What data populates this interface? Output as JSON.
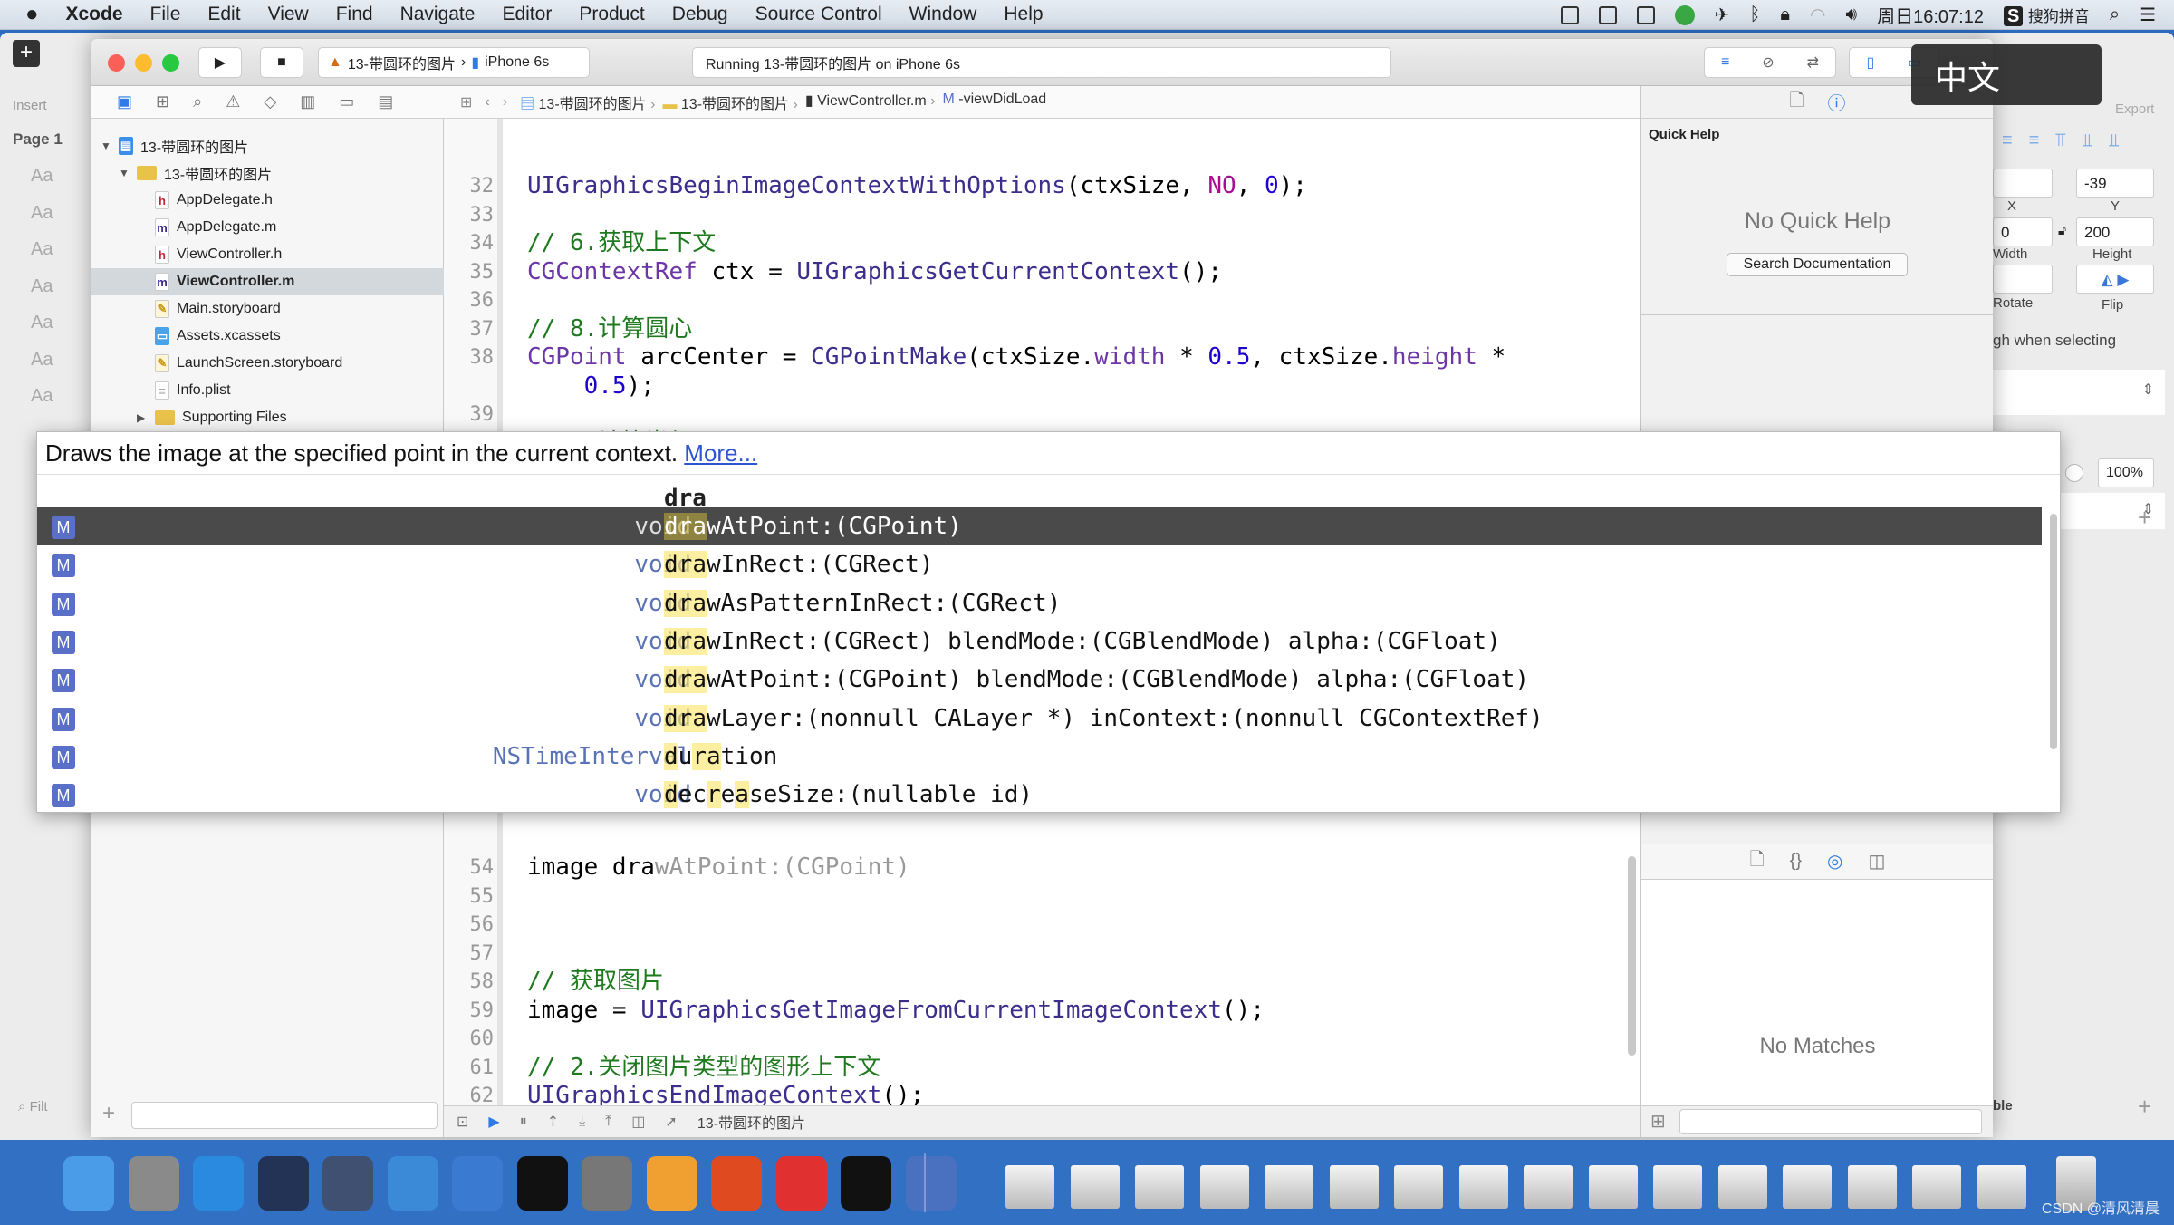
{
  "menubar": {
    "app": "Xcode",
    "items": [
      "File",
      "Edit",
      "View",
      "Find",
      "Navigate",
      "Editor",
      "Product",
      "Debug",
      "Source Control",
      "Window",
      "Help"
    ],
    "clock": "周日16:07:12",
    "ime": "搜狗拼音"
  },
  "ime_overlay": "中文",
  "sketch": {
    "insert": "Insert",
    "export": "Export",
    "page": "Page 1",
    "aa": [
      "Aa",
      "Aa",
      "Aa",
      "Aa",
      "Aa",
      "Aa",
      "Aa"
    ],
    "filter": "Filt",
    "x_label": "X",
    "y_label": "Y",
    "y_value": "-39",
    "width_value": "0",
    "height_value": "200",
    "width_label": "Width",
    "height_label": "Height",
    "rotate_label": "Rotate",
    "flip_label": "Flip",
    "select_through": "gh when selecting",
    "opacity": "100%",
    "bottom_label": "ble"
  },
  "toolbar": {
    "scheme": "13-带圆环的图片",
    "device": "iPhone 6s",
    "activity": "Running 13-带圆环的图片 on iPhone 6s"
  },
  "jumpbar": [
    "13-带圆环的图片",
    "13-带圆环的图片",
    "ViewController.m",
    "-viewDidLoad"
  ],
  "navigator": {
    "items": [
      {
        "label": "13-带圆环的图片",
        "icon": "project",
        "level": 0,
        "disclosure": "open"
      },
      {
        "label": "13-带圆环的图片",
        "icon": "folder",
        "level": 1,
        "disclosure": "open"
      },
      {
        "label": "AppDelegate.h",
        "icon": "h",
        "level": 2
      },
      {
        "label": "AppDelegate.m",
        "icon": "m",
        "level": 2
      },
      {
        "label": "ViewController.h",
        "icon": "h",
        "level": 2
      },
      {
        "label": "ViewController.m",
        "icon": "m",
        "level": 2,
        "selected": true
      },
      {
        "label": "Main.storyboard",
        "icon": "storyboard",
        "level": 2
      },
      {
        "label": "Assets.xcassets",
        "icon": "assets",
        "level": 2
      },
      {
        "label": "LaunchScreen.storyboard",
        "icon": "storyboard",
        "level": 2
      },
      {
        "label": "Info.plist",
        "icon": "plist",
        "level": 2
      },
      {
        "label": "Supporting Files",
        "icon": "folder",
        "level": 2,
        "disclosure": "closed"
      }
    ]
  },
  "code_top": [
    {
      "n": "32",
      "tokens": [
        [
          "UIGraphicsBeginImageContextWithOptions",
          "fn"
        ],
        [
          "(ctxSize, ",
          "pl"
        ],
        [
          "NO",
          "kw"
        ],
        [
          ", ",
          "pl"
        ],
        [
          "0",
          "num"
        ],
        [
          ");",
          "pl"
        ]
      ]
    },
    {
      "n": "33",
      "tokens": []
    },
    {
      "n": "34",
      "tokens": [
        [
          "// 6.获取上下文",
          "cm"
        ]
      ]
    },
    {
      "n": "35",
      "tokens": [
        [
          "CGContextRef",
          "ty"
        ],
        [
          " ctx = ",
          "pl"
        ],
        [
          "UIGraphicsGetCurrentContext",
          "fn"
        ],
        [
          "();",
          "pl"
        ]
      ]
    },
    {
      "n": "36",
      "tokens": []
    },
    {
      "n": "37",
      "tokens": [
        [
          "// 8.计算圆心",
          "cm"
        ]
      ]
    },
    {
      "n": "38",
      "tokens": [
        [
          "CGPoint",
          "ty"
        ],
        [
          " arcCenter = ",
          "pl"
        ],
        [
          "CGPointMake",
          "fn"
        ],
        [
          "(ctxSize.",
          "pl"
        ],
        [
          "width",
          "pr"
        ],
        [
          " * ",
          "pl"
        ],
        [
          "0.5",
          "num"
        ],
        [
          ", ctxSize.",
          "pl"
        ],
        [
          "height",
          "pr"
        ],
        [
          " *",
          "pl"
        ]
      ]
    },
    {
      "n": "",
      "tokens": [
        [
          "    ",
          "pl"
        ],
        [
          "0.5",
          "num"
        ],
        [
          ");",
          "pl"
        ]
      ]
    },
    {
      "n": "39",
      "tokens": []
    },
    {
      "n": "40",
      "tokens": [
        [
          "// 9.计算半径",
          "cm"
        ]
      ]
    },
    {
      "n": "41",
      "tokens": [
        [
          "CGFloat",
          "ty"
        ],
        [
          " radius = (image.size.width + margin) * ",
          "pl"
        ],
        [
          "0.5",
          "num"
        ],
        [
          ";",
          "pl"
        ]
      ]
    }
  ],
  "code_bottom": [
    {
      "n": "54",
      "tokens": [
        [
          "image dra",
          "pl"
        ],
        [
          "wAtPoint:(CGPoint)",
          "ghost"
        ]
      ]
    },
    {
      "n": "55",
      "tokens": []
    },
    {
      "n": "56",
      "tokens": []
    },
    {
      "n": "57",
      "tokens": []
    },
    {
      "n": "58",
      "tokens": [
        [
          "// 获取图片",
          "cm"
        ]
      ]
    },
    {
      "n": "59",
      "tokens": [
        [
          "image = ",
          "pl"
        ],
        [
          "UIGraphicsGetImageFromCurrentImageContext",
          "fn"
        ],
        [
          "();",
          "pl"
        ]
      ]
    },
    {
      "n": "60",
      "tokens": []
    },
    {
      "n": "61",
      "tokens": [
        [
          "// 2.关闭图片类型的图形上下文",
          "cm"
        ]
      ]
    },
    {
      "n": "62",
      "tokens": [
        [
          "UIGraphicsEndImageContext",
          "fn"
        ],
        [
          "();",
          "pl"
        ]
      ]
    },
    {
      "n": "63",
      "tokens": []
    }
  ],
  "completion": {
    "description": "Draws the image at the specified point in the current context.",
    "more_link": "More...",
    "typed": "dra",
    "badge": "M",
    "items": [
      {
        "type": "void",
        "name": "drawAtPoint:(CGPoint)",
        "selected": true
      },
      {
        "type": "void",
        "name": "drawInRect:(CGRect)"
      },
      {
        "type": "void",
        "name": "drawAsPatternInRect:(CGRect)"
      },
      {
        "type": "void",
        "name": "drawInRect:(CGRect) blendMode:(CGBlendMode) alpha:(CGFloat)"
      },
      {
        "type": "void",
        "name": "drawAtPoint:(CGPoint) blendMode:(CGBlendMode) alpha:(CGFloat)"
      },
      {
        "type": "void",
        "name": "drawLayer:(nonnull CALayer *) inContext:(nonnull CGContextRef)"
      },
      {
        "type": "NSTimeInterval",
        "name": "duration"
      },
      {
        "type": "void",
        "name": "decreaseSize:(nullable id)"
      }
    ]
  },
  "debugbar": {
    "target": "13-带圆环的图片"
  },
  "inspector": {
    "title": "Quick Help",
    "empty": "No Quick Help",
    "search_button": "Search Documentation",
    "library_empty": "No Matches"
  },
  "dock": {
    "apps": [
      "Finder",
      "Launchpad",
      "Safari",
      "Mouse",
      "Photo Slideshow",
      "Xcode",
      "Simulator",
      "Terminal",
      "System Preferences",
      "Sketch",
      "PowerPoint",
      "Sogou",
      "Activity Monitor",
      "Keynote"
    ],
    "watermark": "CSDN @清风清晨"
  },
  "colors": {
    "accent": "#2f7ae5",
    "comment": "#1f7a1f",
    "number": "#1c00cf",
    "keyword": "#aa0d91",
    "dock": "#3270c4"
  }
}
